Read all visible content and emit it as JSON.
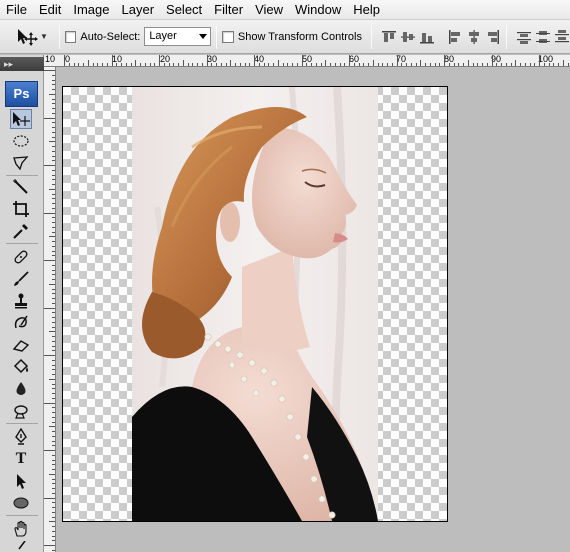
{
  "menubar": {
    "items": [
      "File",
      "Edit",
      "Image",
      "Layer",
      "Select",
      "Filter",
      "View",
      "Window",
      "Help"
    ]
  },
  "options": {
    "auto_select_label": "Auto-Select:",
    "auto_select_checked": false,
    "layer_select_value": "Layer",
    "show_transform_label": "Show Transform Controls",
    "show_transform_checked": false
  },
  "toolbox": {
    "logo": "Ps",
    "grip": "▸▸",
    "tools": [
      {
        "name": "move-tool",
        "icon": "move-icon"
      },
      {
        "name": "marquee-tool",
        "icon": "ellipse-marquee-icon"
      },
      {
        "name": "lasso-tool",
        "icon": "polygonal-lasso-icon"
      },
      {
        "name": "magic-wand-tool",
        "icon": "magic-wand-icon"
      },
      {
        "name": "crop-tool",
        "icon": "crop-icon"
      },
      {
        "name": "eyedropper-tool",
        "icon": "eyedropper-icon"
      },
      {
        "name": "healing-brush-tool",
        "icon": "bandage-icon"
      },
      {
        "name": "brush-tool",
        "icon": "brush-icon"
      },
      {
        "name": "clone-stamp-tool",
        "icon": "stamp-icon"
      },
      {
        "name": "history-brush-tool",
        "icon": "history-brush-icon"
      },
      {
        "name": "eraser-tool",
        "icon": "eraser-icon"
      },
      {
        "name": "paint-bucket-tool",
        "icon": "bucket-icon"
      },
      {
        "name": "blur-tool",
        "icon": "drop-icon"
      },
      {
        "name": "dodge-tool",
        "icon": "dodge-icon"
      },
      {
        "name": "pen-tool",
        "icon": "pen-icon"
      },
      {
        "name": "type-tool",
        "icon": "type-icon"
      },
      {
        "name": "path-selection-tool",
        "icon": "arrow-icon"
      },
      {
        "name": "ellipse-tool",
        "icon": "ellipse-icon"
      },
      {
        "name": "hand-tool",
        "icon": "hand-icon"
      }
    ],
    "type_glyph": "T"
  },
  "ruler": {
    "labels": [
      "10",
      "0",
      "10",
      "20",
      "30",
      "40",
      "50",
      "60",
      "70",
      "80",
      "90",
      "100"
    ]
  },
  "colors": {
    "menubar": "#efefef",
    "checkerboard": "#cccccc",
    "workspace": "#bdbdbd",
    "ps_blue": "#2b5fb4"
  }
}
